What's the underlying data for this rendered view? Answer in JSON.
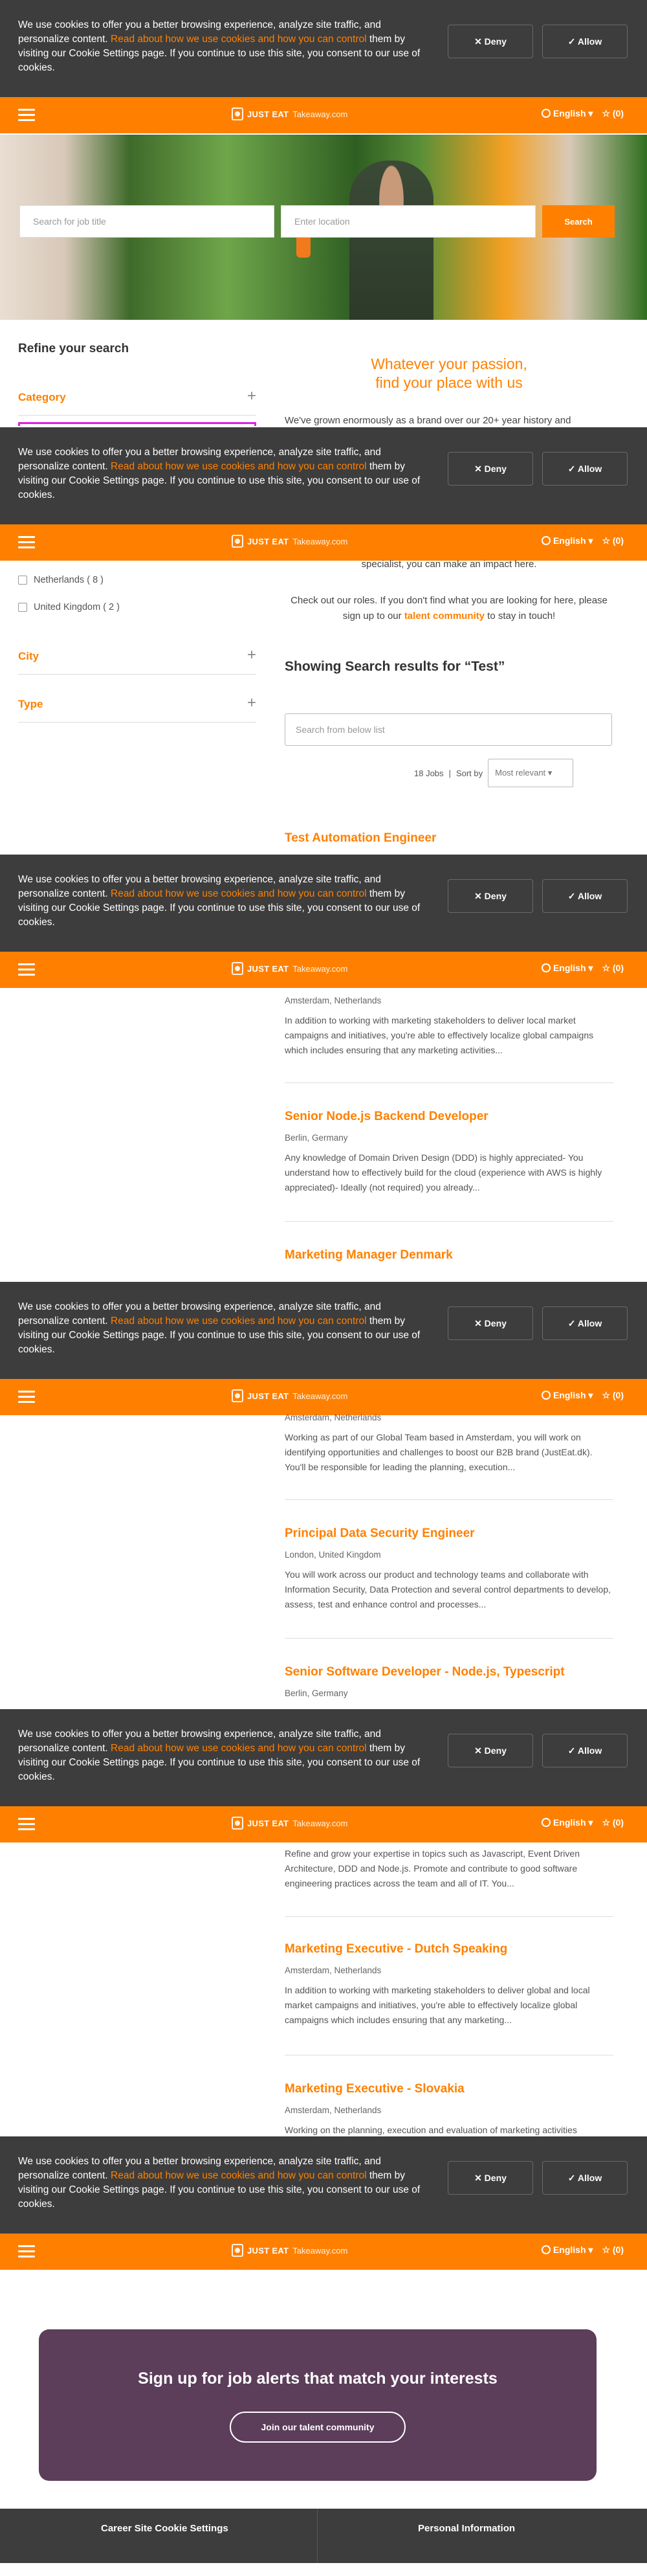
{
  "cookie": {
    "text_before": "We use cookies to offer you a better browsing experience, analyze site traffic, and personalize content. ",
    "link": "Read about how we use cookies and how you can control",
    "text_after": " them by visiting our Cookie Settings page. If you continue to use this site, you consent to our use of cookies.",
    "deny": "✕ Deny",
    "allow": "✓ Allow"
  },
  "header": {
    "logo_primary": "JUST EAT",
    "logo_secondary": "Takeaway.com",
    "language": "English ▾",
    "favorites": "☆ (0)"
  },
  "hero": {
    "job_placeholder": "Search for job title",
    "location_placeholder": "Enter location",
    "search_button": "Search"
  },
  "filters": {
    "title": "Refine your search",
    "category": "Category",
    "countries": [
      "Netherlands ( 8 )",
      "United Kingdom ( 2 )"
    ],
    "city": "City",
    "type": "Type"
  },
  "intro": {
    "heading_line1": "Whatever your passion,",
    "heading_line2": "find your place with us",
    "para_top": "We've grown enormously as a brand over our 20+ year history and",
    "para_cont": "specialist, you can make an impact here.",
    "cta_before": "Check out our roles. If you don't find what you are looking for here, please sign up to our ",
    "cta_link": "talent community",
    "cta_after": " to stay in touch!"
  },
  "results": {
    "heading": "Showing Search results for “Test”",
    "search_placeholder": "Search from below list",
    "count": "18 Jobs",
    "sort_label": "Sort by",
    "sort_value": "Most relevant ▾"
  },
  "jobs": [
    {
      "title": "Test Automation Engineer"
    },
    {
      "location": "Amsterdam, Netherlands",
      "desc": "In addition to working with marketing stakeholders to deliver local market campaigns and initiatives, you're able to effectively localize global campaigns which includes ensuring that any marketing activities..."
    },
    {
      "title": "Senior Node.js Backend Developer",
      "location": "Berlin, Germany",
      "desc": "Any knowledge of Domain Driven Design (DDD) is highly appreciated- You understand how to effectively build for the cloud (experience with AWS is highly appreciated)- Ideally (not required) you already..."
    },
    {
      "title": "Marketing Manager Denmark"
    },
    {
      "location": "Amsterdam, Netherlands",
      "desc": "Working as part of our Global Team based in Amsterdam, you will work on identifying opportunities and challenges to boost our B2B brand (JustEat.dk). You'll be responsible for leading the planning, execution..."
    },
    {
      "title": "Principal Data Security Engineer",
      "location": "London, United Kingdom",
      "desc": "You will work across our product and technology teams and collaborate with Information Security, Data Protection and several control departments to develop, assess, test and enhance control and processes..."
    },
    {
      "title": "Senior Software Developer - Node.js, Typescript",
      "location": "Berlin, Germany"
    },
    {
      "desc": "Refine and grow your expertise in topics such as Javascript, Event Driven Architecture, DDD and Node.js. Promote and contribute to good software engineering practices across the team and all of IT. You..."
    },
    {
      "title": "Marketing Executive - Dutch Speaking",
      "location": "Amsterdam, Netherlands",
      "desc": "In addition to working with marketing stakeholders to deliver global and local market campaigns and initiatives, you're able to effectively localize global campaigns which includes ensuring that any marketing..."
    },
    {
      "title": "Marketing Executive - Slovakia",
      "location": "Amsterdam, Netherlands",
      "desc": "Working on the planning, execution and evaluation of marketing activities"
    }
  ],
  "signup": {
    "heading": "Sign up for job alerts that match your interests",
    "button": "Join our talent community"
  },
  "footer": {
    "cookie_settings": "Career Site Cookie Settings",
    "personal_info": "Personal Information"
  },
  "colors": {
    "brand": "#ff8000",
    "banner": "#3d3d3d",
    "signup": "#5c3d5a"
  }
}
